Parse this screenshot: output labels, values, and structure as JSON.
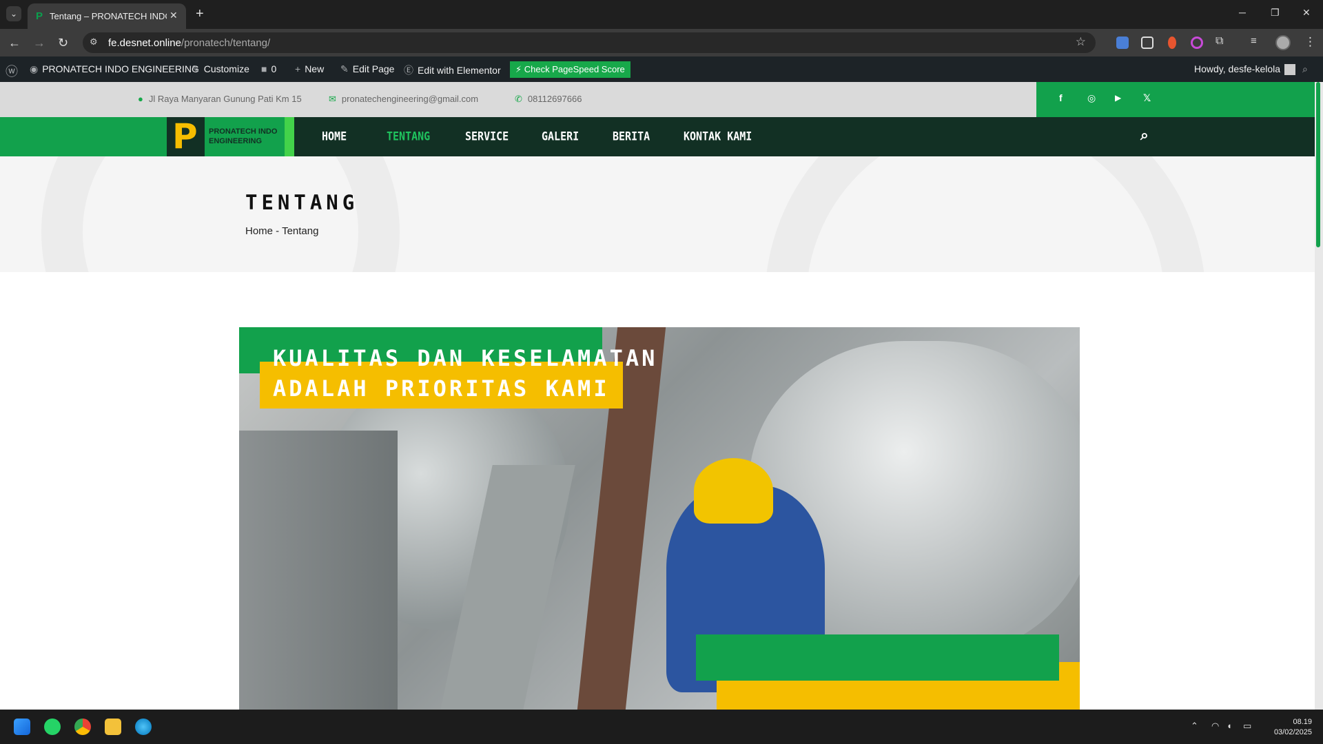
{
  "browser": {
    "tab_title": "Tentang – PRONATECH INDO E",
    "tab_close": "✕",
    "new_tab": "+",
    "url_domain": "fe.desnet.online",
    "url_path": "/pronatech/tentang/"
  },
  "wp_admin_bar": {
    "site_name": "PRONATECH INDO ENGINEERING",
    "customize": "Customize",
    "comments_count": "0",
    "new": "New",
    "edit_page": "Edit Page",
    "edit_elementor": "Edit with Elementor",
    "pagespeed": "Check PageSpeed Score",
    "howdy": "Howdy, desfe-kelola"
  },
  "topbar": {
    "address": "Jl Raya Manyaran Gunung Pati Km 15",
    "email": "pronatechengineering@gmail.com",
    "phone": "08112697666",
    "social": [
      "f",
      "◎",
      "▶",
      "𝕏"
    ]
  },
  "logo": {
    "mark": "P",
    "text": "PRONATECH INDO ENGINEERING"
  },
  "nav": {
    "items": [
      "HOME",
      "TENTANG",
      "SERVICE",
      "GALERI",
      "BERITA",
      "KONTAK KAMI"
    ],
    "active": "TENTANG"
  },
  "hero": {
    "title": "TENTANG",
    "breadcrumb": "Home - Tentang"
  },
  "feature": {
    "headline_line1": "KUALITAS DAN KESELAMATAN",
    "headline_line2": "ADALAH PRIORITAS KAMI"
  },
  "taskbar": {
    "time": "08.19",
    "date": "03/02/2025"
  },
  "colors": {
    "brand_green": "#12a14c",
    "brand_dark": "#123024",
    "brand_yellow": "#f5be00",
    "nav_active": "#1fc45e"
  }
}
